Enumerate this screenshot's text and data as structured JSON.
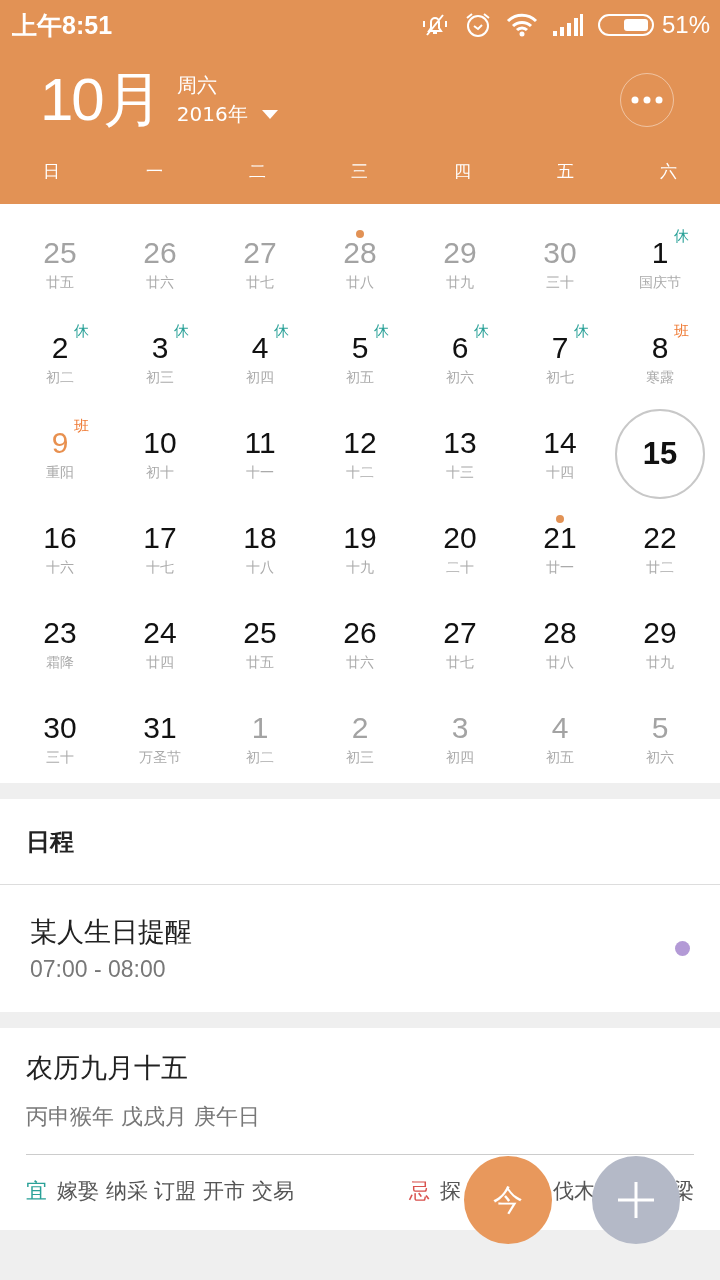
{
  "status_bar": {
    "time": "上午8:51",
    "battery": "51%"
  },
  "header": {
    "month": "10月",
    "weekday": "周六",
    "year": "2016年"
  },
  "weekdays": [
    "日",
    "一",
    "二",
    "三",
    "四",
    "五",
    "六"
  ],
  "weeks": [
    [
      {
        "day": "25",
        "lunar": "廿五",
        "other_month": true,
        "selected": false
      },
      {
        "day": "26",
        "lunar": "廿六",
        "other_month": true,
        "selected": false
      },
      {
        "day": "27",
        "lunar": "廿七",
        "other_month": true,
        "selected": false
      },
      {
        "day": "28",
        "lunar": "廿八",
        "other_month": true,
        "selected": false,
        "dot": true
      },
      {
        "day": "29",
        "lunar": "廿九",
        "other_month": true,
        "selected": false
      },
      {
        "day": "30",
        "lunar": "三十",
        "other_month": true,
        "selected": false
      },
      {
        "day": "1",
        "lunar": "国庆节",
        "other_month": false,
        "selected": false,
        "badge": {
          "text": "休",
          "kind": "rest"
        }
      }
    ],
    [
      {
        "day": "2",
        "lunar": "初二",
        "other_month": false,
        "selected": false,
        "badge": {
          "text": "休",
          "kind": "rest"
        }
      },
      {
        "day": "3",
        "lunar": "初三",
        "other_month": false,
        "selected": false,
        "badge": {
          "text": "休",
          "kind": "rest"
        }
      },
      {
        "day": "4",
        "lunar": "初四",
        "other_month": false,
        "selected": false,
        "badge": {
          "text": "休",
          "kind": "rest"
        }
      },
      {
        "day": "5",
        "lunar": "初五",
        "other_month": false,
        "selected": false,
        "badge": {
          "text": "休",
          "kind": "rest"
        }
      },
      {
        "day": "6",
        "lunar": "初六",
        "other_month": false,
        "selected": false,
        "badge": {
          "text": "休",
          "kind": "rest"
        }
      },
      {
        "day": "7",
        "lunar": "初七",
        "other_month": false,
        "selected": false,
        "badge": {
          "text": "休",
          "kind": "rest"
        }
      },
      {
        "day": "8",
        "lunar": "寒露",
        "other_month": false,
        "selected": false,
        "badge": {
          "text": "班",
          "kind": "work"
        }
      }
    ],
    [
      {
        "day": "9",
        "lunar": "重阳",
        "other_month": false,
        "selected": false,
        "highlight": true,
        "badge": {
          "text": "班",
          "kind": "work"
        }
      },
      {
        "day": "10",
        "lunar": "初十",
        "other_month": false,
        "selected": false
      },
      {
        "day": "11",
        "lunar": "十一",
        "other_month": false,
        "selected": false
      },
      {
        "day": "12",
        "lunar": "十二",
        "other_month": false,
        "selected": false
      },
      {
        "day": "13",
        "lunar": "十三",
        "other_month": false,
        "selected": false
      },
      {
        "day": "14",
        "lunar": "十四",
        "other_month": false,
        "selected": false
      },
      {
        "day": "15",
        "other_month": false,
        "selected": true
      }
    ],
    [
      {
        "day": "16",
        "lunar": "十六",
        "other_month": false,
        "selected": false
      },
      {
        "day": "17",
        "lunar": "十七",
        "other_month": false,
        "selected": false
      },
      {
        "day": "18",
        "lunar": "十八",
        "other_month": false,
        "selected": false
      },
      {
        "day": "19",
        "lunar": "十九",
        "other_month": false,
        "selected": false
      },
      {
        "day": "20",
        "lunar": "二十",
        "other_month": false,
        "selected": false
      },
      {
        "day": "21",
        "lunar": "廿一",
        "other_month": false,
        "selected": false,
        "dot": true
      },
      {
        "day": "22",
        "lunar": "廿二",
        "other_month": false,
        "selected": false
      }
    ],
    [
      {
        "day": "23",
        "lunar": "霜降",
        "other_month": false,
        "selected": false
      },
      {
        "day": "24",
        "lunar": "廿四",
        "other_month": false,
        "selected": false
      },
      {
        "day": "25",
        "lunar": "廿五",
        "other_month": false,
        "selected": false
      },
      {
        "day": "26",
        "lunar": "廿六",
        "other_month": false,
        "selected": false
      },
      {
        "day": "27",
        "lunar": "廿七",
        "other_month": false,
        "selected": false
      },
      {
        "day": "28",
        "lunar": "廿八",
        "other_month": false,
        "selected": false
      },
      {
        "day": "29",
        "lunar": "廿九",
        "other_month": false,
        "selected": false
      }
    ],
    [
      {
        "day": "30",
        "lunar": "三十",
        "other_month": false,
        "selected": false
      },
      {
        "day": "31",
        "lunar": "万圣节",
        "other_month": false,
        "selected": false
      },
      {
        "day": "1",
        "lunar": "初二",
        "other_month": true,
        "selected": false
      },
      {
        "day": "2",
        "lunar": "初三",
        "other_month": true,
        "selected": false
      },
      {
        "day": "3",
        "lunar": "初四",
        "other_month": true,
        "selected": false
      },
      {
        "day": "4",
        "lunar": "初五",
        "other_month": true,
        "selected": false
      },
      {
        "day": "5",
        "lunar": "初六",
        "other_month": true,
        "selected": false
      }
    ]
  ],
  "schedule": {
    "title": "日程",
    "events": [
      {
        "title": "某人生日提醒",
        "time": "07:00 - 08:00",
        "color": "#b39ad6"
      }
    ]
  },
  "almanac": {
    "lunar_date": "农历九月十五",
    "ganzhi": "丙申猴年 戊戌月 庚午日",
    "suitable_label": "宜",
    "suitable": "嫁娶 纳采 订盟 开市 交易",
    "avoid_label": "忌",
    "avoid": [
      "探",
      "伐木",
      "梁"
    ]
  },
  "fabs": {
    "today": "今"
  }
}
